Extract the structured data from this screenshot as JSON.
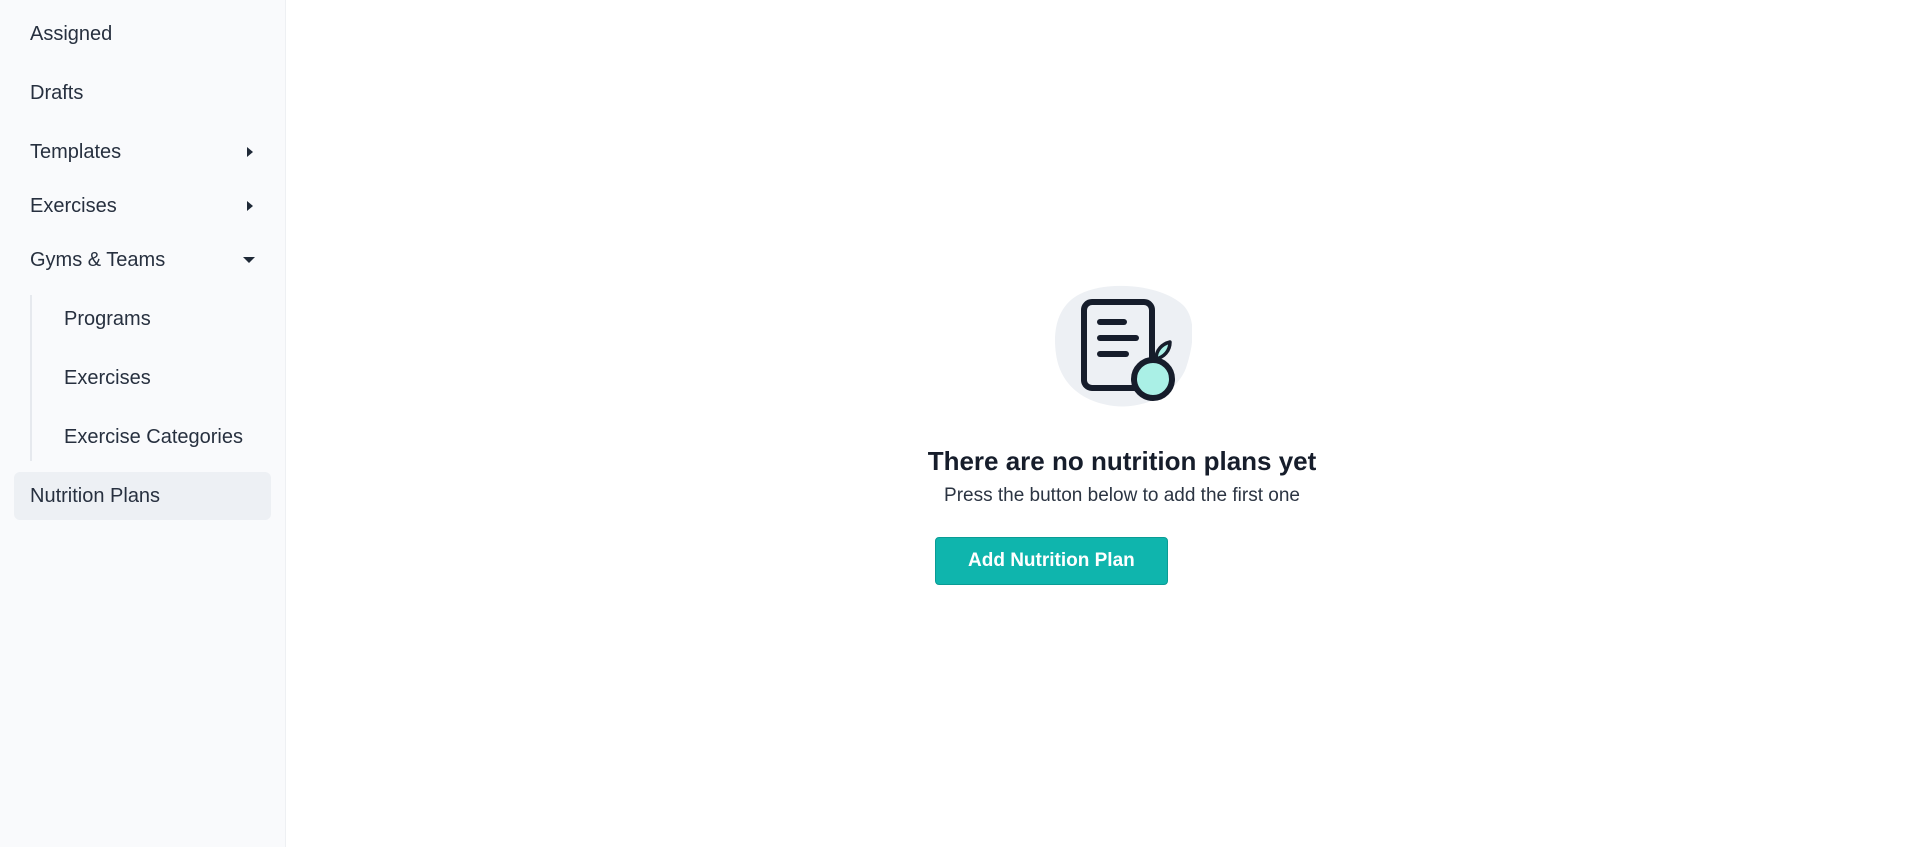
{
  "sidebar": {
    "items": [
      {
        "label": "Assigned"
      },
      {
        "label": "Drafts"
      },
      {
        "label": "Templates"
      },
      {
        "label": "Exercises"
      },
      {
        "label": "Gyms & Teams"
      },
      {
        "label": "Programs"
      },
      {
        "label": "Exercises"
      },
      {
        "label": "Exercise Categories"
      },
      {
        "label": "Nutrition Plans"
      }
    ]
  },
  "empty_state": {
    "title": "There are no nutrition plans yet",
    "subtitle": "Press the button below to add the first one",
    "button_label": "Add Nutrition Plan",
    "illustration_icon": "nutrition-plan-document-apple-icon"
  },
  "colors": {
    "accent": "#0fb5ad",
    "sidebar_bg": "#f9fafc",
    "active_bg": "#edf0f4",
    "apple_fill": "#aaf0e6"
  }
}
